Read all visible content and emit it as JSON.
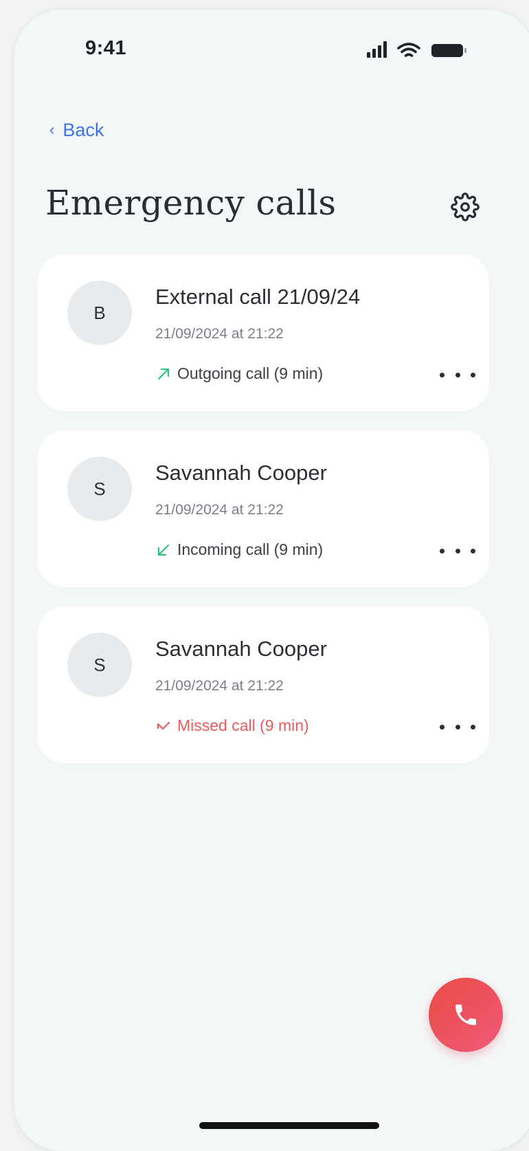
{
  "status_bar": {
    "time": "9:41",
    "icons": [
      "cellular-signal-icon",
      "wifi-icon",
      "battery-icon"
    ]
  },
  "nav": {
    "back_label": "Back"
  },
  "header": {
    "title": "Emergency calls",
    "settings_icon": "gear-icon"
  },
  "calls": [
    {
      "avatar_initial": "B",
      "name": "External call 21/09/24",
      "date": "21/09/2024 at 21:22",
      "status": "Outgoing call (9 min)",
      "type": "outgoing",
      "icon": "arrow-up-right-icon",
      "color": "#2ec27e"
    },
    {
      "avatar_initial": "S",
      "name": "Savannah Cooper",
      "date": "21/09/2024 at 21:22",
      "status": "Incoming call (9 min)",
      "type": "incoming",
      "icon": "arrow-down-left-icon",
      "color": "#2ec27e"
    },
    {
      "avatar_initial": "S",
      "name": "Savannah Cooper",
      "date": "21/09/2024 at 21:22",
      "status": "Missed call (9 min)",
      "type": "missed",
      "icon": "missed-call-arrow-icon",
      "color": "#ea5c5c"
    }
  ],
  "fab": {
    "icon": "phone-icon",
    "gradient_start": "#eb4a45",
    "gradient_end": "#ee5a78"
  },
  "colors": {
    "accent": "#3b73e6",
    "missed": "#ea5c5c",
    "success": "#2ec27e",
    "card": "#ffffff",
    "background": "#f4f7f8"
  }
}
